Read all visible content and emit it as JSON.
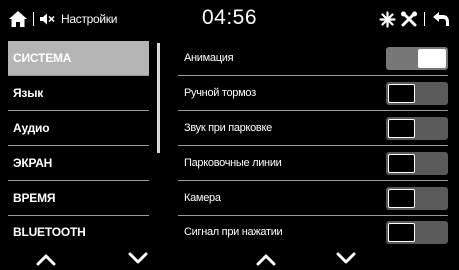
{
  "statusbar": {
    "title": "Настройки",
    "time": "04:56",
    "icons": [
      "home-icon",
      "mute-speaker-icon",
      "bluetooth-icon",
      "tools-icon",
      "back-icon"
    ]
  },
  "menu": {
    "items": [
      {
        "label": "СИСТЕМА",
        "active": true
      },
      {
        "label": "Язык",
        "active": false
      },
      {
        "label": "Аудио",
        "active": false
      },
      {
        "label": "ЭКРАН",
        "active": false
      },
      {
        "label": "ВРЕМЯ",
        "active": false
      },
      {
        "label": "BLUETOOTH",
        "active": false
      }
    ]
  },
  "settings": {
    "rows": [
      {
        "label": "Анимация",
        "toggle": "on"
      },
      {
        "label": "Ручной тормоз",
        "toggle": "off"
      },
      {
        "label": "Звук при парковке",
        "toggle": "off"
      },
      {
        "label": "Парковочные линии",
        "toggle": "off"
      },
      {
        "label": "Камера",
        "toggle": "off"
      },
      {
        "label": "Сигнал при нажатии",
        "toggle": "off"
      }
    ]
  },
  "bottom": {
    "icons": [
      "menu-scroll-up-icon",
      "menu-scroll-down-icon",
      "settings-scroll-up-icon",
      "settings-scroll-down-icon"
    ]
  }
}
